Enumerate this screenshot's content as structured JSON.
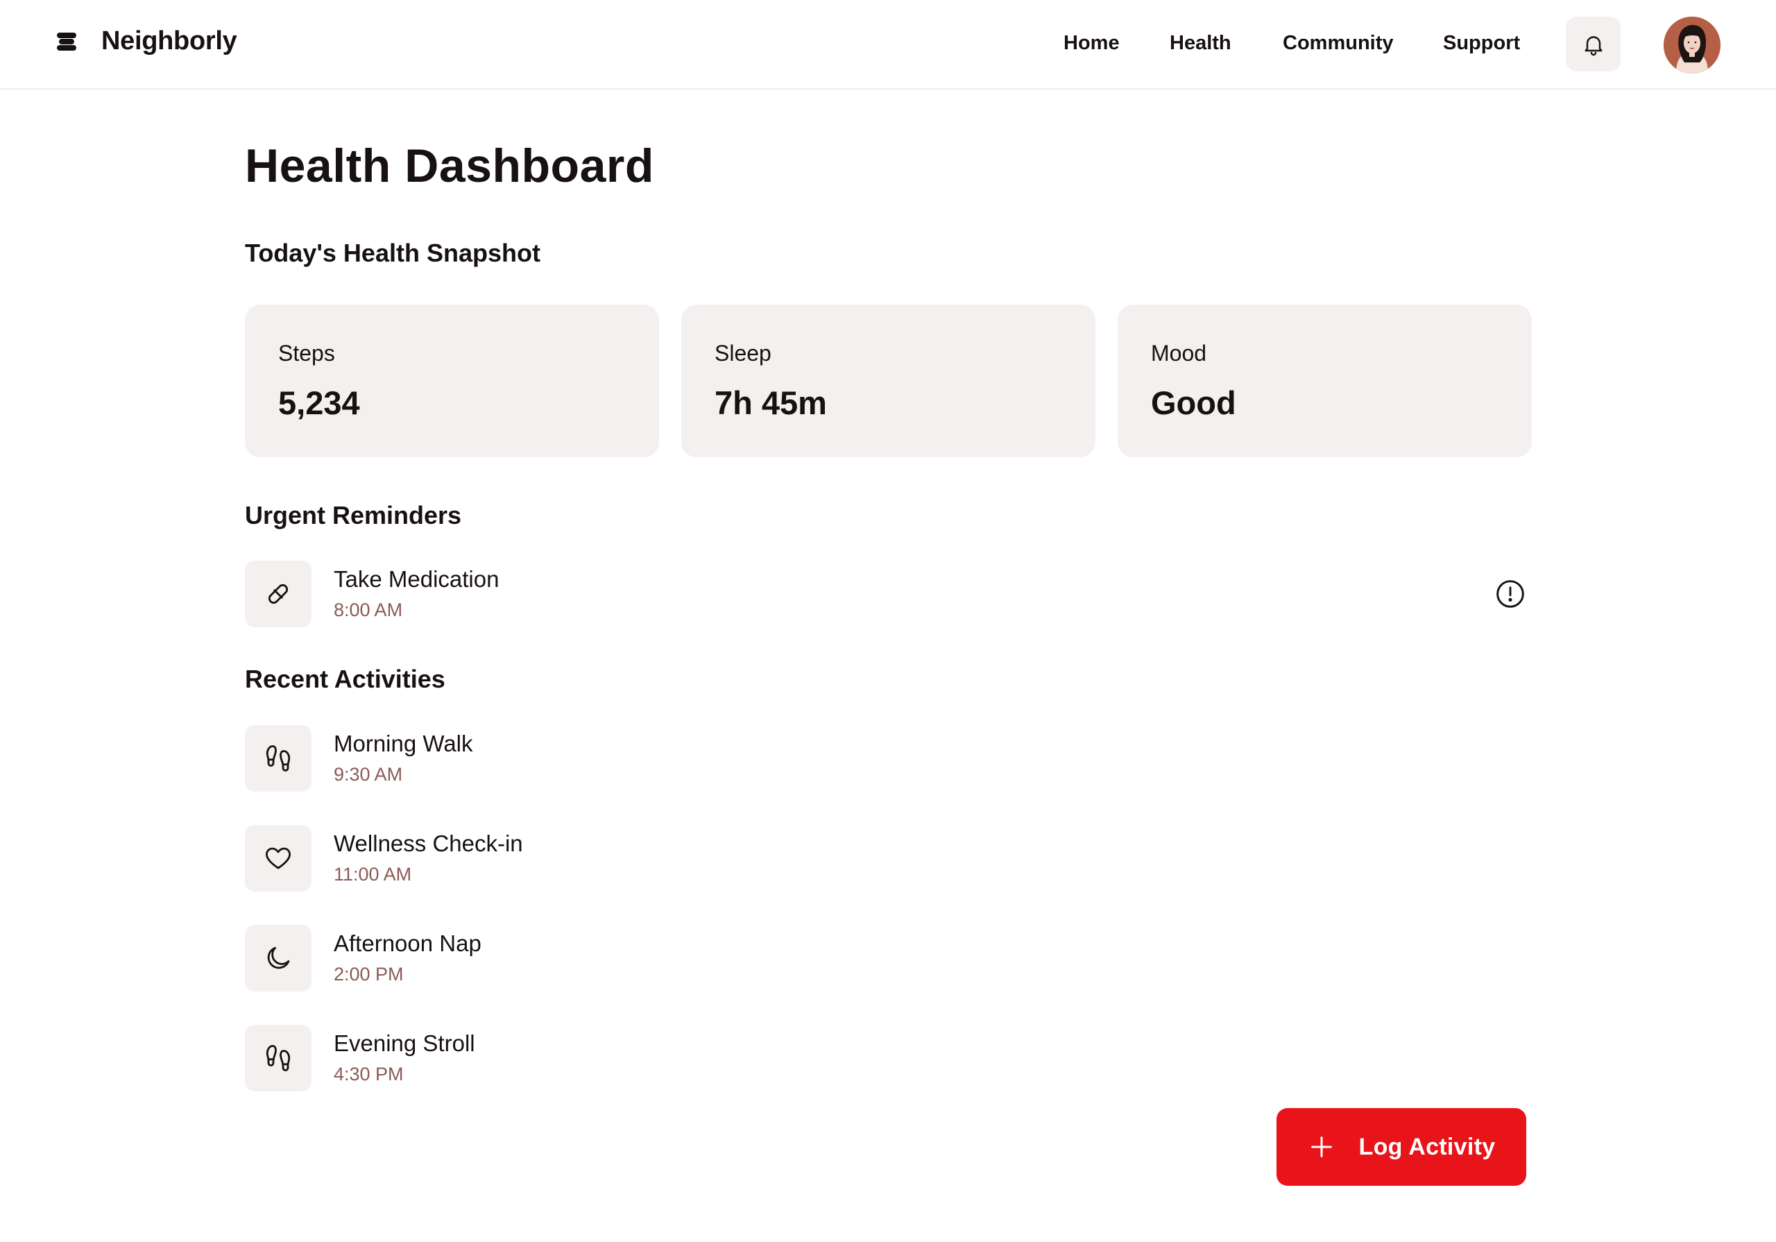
{
  "brand": {
    "name": "Neighborly",
    "logo_icon": "stacked-layers-logo"
  },
  "nav": {
    "items": [
      {
        "label": "Home"
      },
      {
        "label": "Health"
      },
      {
        "label": "Community"
      },
      {
        "label": "Support"
      }
    ],
    "notifications_icon": "bell-icon",
    "avatar_icon": "user-avatar"
  },
  "page": {
    "title": "Health Dashboard"
  },
  "snapshot": {
    "heading": "Today's Health Snapshot",
    "cards": [
      {
        "label": "Steps",
        "value": "5,234"
      },
      {
        "label": "Sleep",
        "value": "7h 45m"
      },
      {
        "label": "Mood",
        "value": "Good"
      }
    ]
  },
  "reminders": {
    "heading": "Urgent Reminders",
    "items": [
      {
        "title": "Take Medication",
        "time": "8:00 AM",
        "icon": "pill-icon",
        "status_icon": "alert-circle-icon"
      }
    ]
  },
  "activities": {
    "heading": "Recent Activities",
    "items": [
      {
        "title": "Morning Walk",
        "time": "9:30 AM",
        "icon": "footprints-icon"
      },
      {
        "title": "Wellness Check-in",
        "time": "11:00 AM",
        "icon": "heart-icon"
      },
      {
        "title": "Afternoon Nap",
        "time": "2:00 PM",
        "icon": "moon-icon"
      },
      {
        "title": "Evening Stroll",
        "time": "4:30 PM",
        "icon": "footprints-icon"
      }
    ]
  },
  "actions": {
    "log_activity_label": "Log Activity",
    "log_activity_icon": "plus-icon"
  },
  "colors": {
    "accent": "#e8141a",
    "card_bg": "#f4f0f0",
    "muted_text": "#8a5b55",
    "text": "#181111"
  }
}
